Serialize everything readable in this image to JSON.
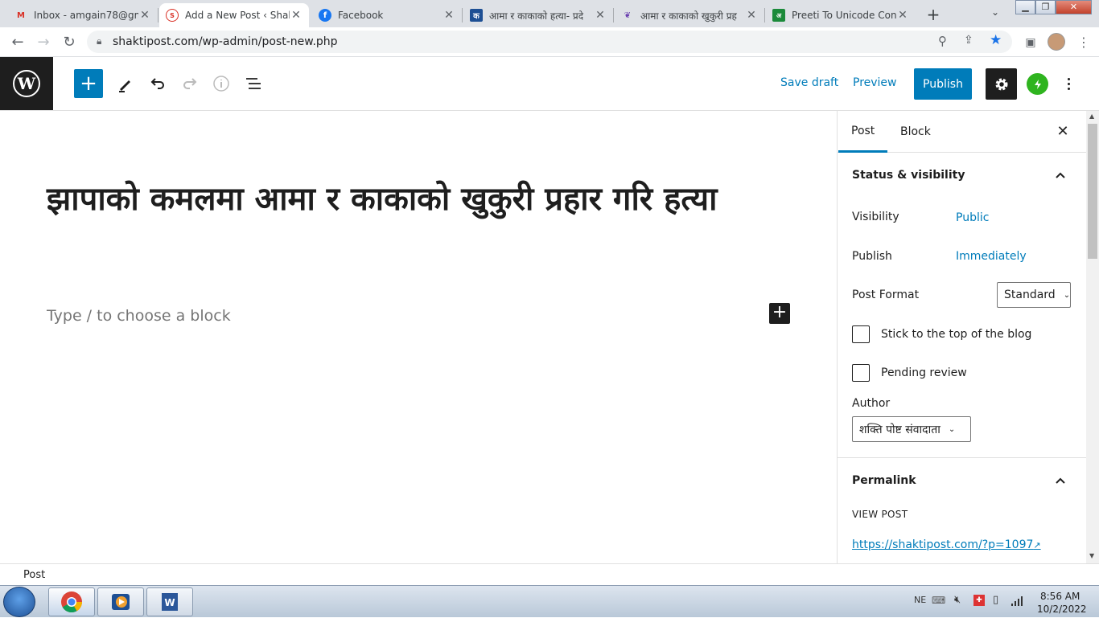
{
  "browser": {
    "tabs": [
      {
        "title": "Inbox - amgain78@gm",
        "icon": "gmail-icon",
        "active": false
      },
      {
        "title": "Add a New Post ‹ Shakt",
        "icon": "shaktipost-icon",
        "active": true
      },
      {
        "title": "Facebook",
        "icon": "facebook-icon",
        "active": false
      },
      {
        "title": "आमा र काकाको हत्या- प्रदे",
        "icon": "news-site-icon",
        "active": false
      },
      {
        "title": "आमा र काकाको खुकुरी प्रह",
        "icon": "news-site-icon",
        "active": false
      },
      {
        "title": "Preeti To Unicode Conv",
        "icon": "preeti-icon",
        "active": false
      }
    ],
    "url": "shaktipost.com/wp-admin/post-new.php"
  },
  "header": {
    "save_draft": "Save draft",
    "preview": "Preview",
    "publish": "Publish"
  },
  "editor": {
    "title": "झापाको कमलमा आमा र काकाको खुकुरी प्रहार गरि हत्या",
    "placeholder": "Type / to choose a block"
  },
  "sidebar": {
    "tabs": [
      "Post",
      "Block"
    ],
    "status_visibility": {
      "title": "Status & visibility",
      "visibility_label": "Visibility",
      "visibility_value": "Public",
      "publish_label": "Publish",
      "publish_value": "Immediately",
      "post_format_label": "Post Format",
      "post_format_value": "Standard",
      "sticky_label": "Stick to the top of the blog",
      "pending_label": "Pending review",
      "author_label": "Author",
      "author_value": "शक्ति पोष्ट संवादाता"
    },
    "permalink": {
      "title": "Permalink",
      "view_post": "VIEW POST",
      "url": "https://shaktipost.com/?p=1097"
    }
  },
  "footer": {
    "breadcrumb": "Post"
  },
  "taskbar": {
    "language": "NE",
    "time": "8:56 AM",
    "date": "10/2/2022"
  },
  "colors": {
    "accent": "#007cba",
    "dark": "#1e1e1e",
    "jetpack": "#2fb41f"
  }
}
